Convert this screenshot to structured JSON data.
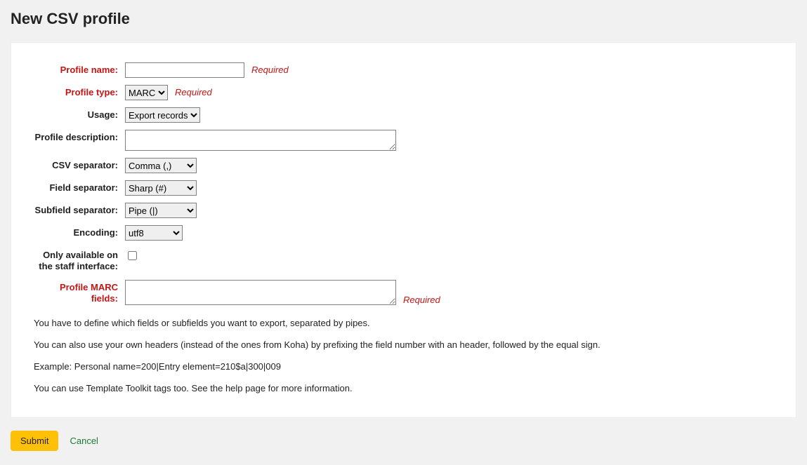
{
  "title": "New CSV profile",
  "requiredText": "Required",
  "fields": {
    "profileName": {
      "label": "Profile name:",
      "value": ""
    },
    "profileType": {
      "label": "Profile type:",
      "options": [
        "MARC"
      ],
      "value": "MARC"
    },
    "usage": {
      "label": "Usage:",
      "options": [
        "Export records"
      ],
      "value": "Export records"
    },
    "profileDescription": {
      "label": "Profile description:",
      "value": ""
    },
    "csvSeparator": {
      "label": "CSV separator:",
      "options": [
        "Comma (,)"
      ],
      "value": "Comma (,)"
    },
    "fieldSeparator": {
      "label": "Field separator:",
      "options": [
        "Sharp (#)"
      ],
      "value": "Sharp (#)"
    },
    "subfieldSeparator": {
      "label": "Subfield separator:",
      "options": [
        "Pipe (|)"
      ],
      "value": "Pipe (|)"
    },
    "encoding": {
      "label": "Encoding:",
      "options": [
        "utf8"
      ],
      "value": "utf8"
    },
    "onlyStaff": {
      "label": "Only available on the staff interface:",
      "checked": false
    },
    "marcFields": {
      "label": "Profile MARC fields:",
      "value": ""
    }
  },
  "help": [
    "You have to define which fields or subfields you want to export, separated by pipes.",
    "You can also use your own headers (instead of the ones from Koha) by prefixing the field number with an header, followed by the equal sign.",
    "Example: Personal name=200|Entry element=210$a|300|009",
    "You can use Template Toolkit tags too. See the help page for more information."
  ],
  "actions": {
    "submit": "Submit",
    "cancel": "Cancel"
  }
}
